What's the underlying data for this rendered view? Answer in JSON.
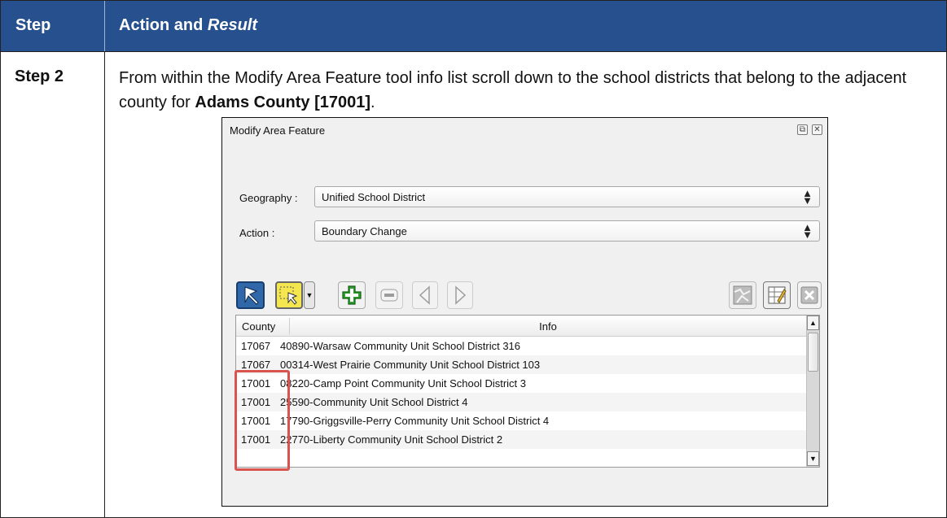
{
  "header": {
    "col_step": "Step",
    "col_action": "Action and ",
    "col_result": "Result"
  },
  "step": {
    "label": "Step 2",
    "text_before": "From within the Modify Area Feature tool info list scroll down to the school districts that belong to the adjacent county for ",
    "text_bold": "Adams County [17001]",
    "text_after": "."
  },
  "dialog": {
    "title": "Modify Area Feature",
    "geography_label": "Geography :",
    "geography_value": "Unified School District",
    "action_label": "Action :",
    "action_value": "Boundary Change",
    "list": {
      "columns": [
        "County",
        "Info"
      ],
      "rows": [
        {
          "county": "17067",
          "info": "40890-Warsaw Community Unit School District 316"
        },
        {
          "county": "17067",
          "info": "00314-West Prairie Community Unit School District 103"
        },
        {
          "county": "17001",
          "info": "08220-Camp Point Community Unit School District 3"
        },
        {
          "county": "17001",
          "info": "25590-Community Unit School District 4"
        },
        {
          "county": "17001",
          "info": "17790-Griggsville-Perry Community Unit School District 4"
        },
        {
          "county": "17001",
          "info": "22770-Liberty Community Unit School District 2"
        }
      ]
    }
  },
  "colors": {
    "header_bg": "#27508f",
    "highlight": "#d9534f",
    "select_yellow": "#f3e64f",
    "add_green": "#2e9e2e"
  }
}
